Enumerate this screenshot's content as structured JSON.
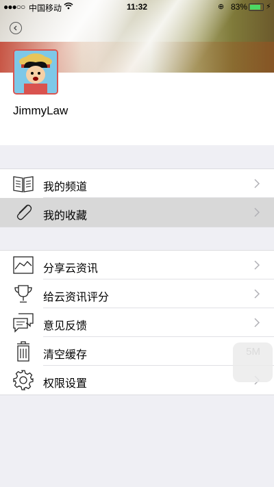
{
  "status_bar": {
    "signal": "●●●○○",
    "carrier": "中国移动",
    "time": "11:32",
    "battery_percent": "83%",
    "battery_level": 0.83
  },
  "profile": {
    "username": "JimmyLaw"
  },
  "menu_group_1": [
    {
      "label": "我的频道",
      "icon": "book-icon"
    },
    {
      "label": "我的收藏",
      "icon": "paperclip-icon"
    }
  ],
  "menu_group_2": [
    {
      "label": "分享云资讯",
      "icon": "chart-icon"
    },
    {
      "label": "给云资讯评分",
      "icon": "trophy-icon"
    },
    {
      "label": "意见反馈",
      "icon": "chat-bubbles-icon"
    },
    {
      "label": "清空缓存",
      "icon": "trash-icon",
      "value": "5M"
    },
    {
      "label": "权限设置",
      "icon": "gear-icon"
    }
  ]
}
